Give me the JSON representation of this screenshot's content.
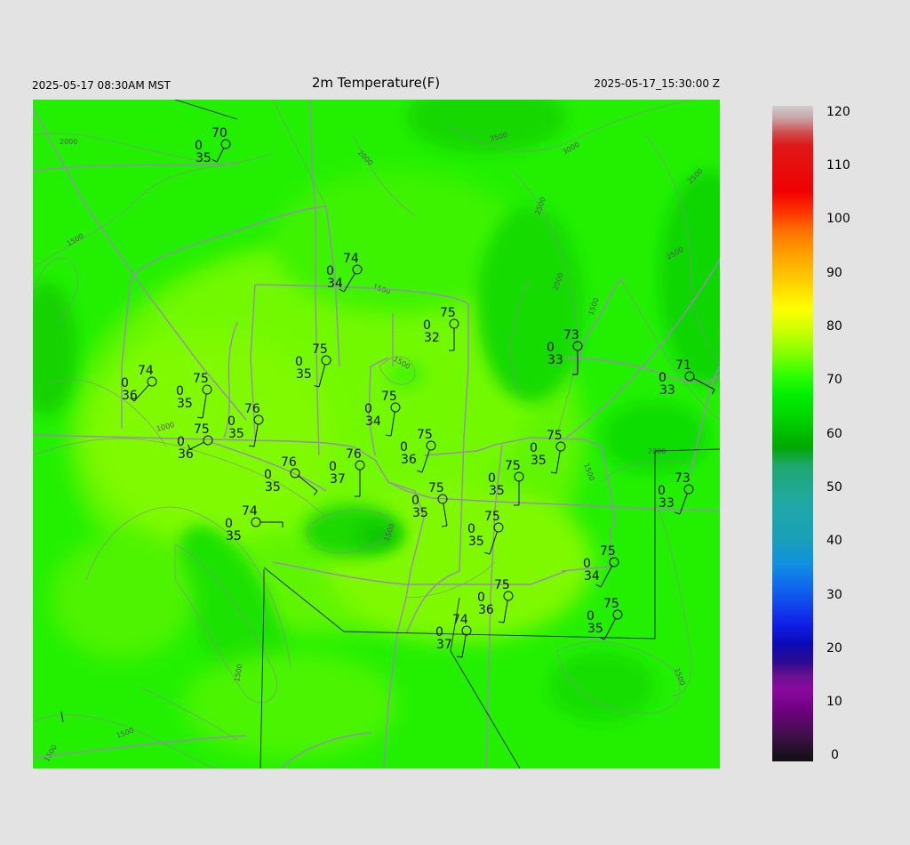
{
  "header": {
    "local_time": "2025-05-17 08:30AM MST",
    "title": "2m Temperature(F)",
    "utc_time": "2025-05-17_15:30:00 Z"
  },
  "map": {
    "base_color": "#22f000",
    "contour_labels": [
      "2000",
      "2000",
      "3500",
      "3000",
      "2500",
      "2500",
      "2500",
      "2000",
      "1500",
      "1500",
      "1500",
      "1500",
      "1000",
      "1500",
      "2000",
      "1500",
      "1500",
      "1500",
      "1500",
      "1500"
    ]
  },
  "stations": [
    {
      "temp": "70",
      "calm": "0",
      "dew": "35"
    },
    {
      "temp": "74",
      "calm": "0",
      "dew": "34"
    },
    {
      "temp": "75",
      "calm": "0",
      "dew": "32"
    },
    {
      "temp": "73",
      "calm": "0",
      "dew": "33"
    },
    {
      "temp": "71",
      "calm": "0",
      "dew": "33"
    },
    {
      "temp": "75",
      "calm": "0",
      "dew": "35"
    },
    {
      "temp": "74",
      "calm": "0",
      "dew": "36"
    },
    {
      "temp": "75",
      "calm": "0",
      "dew": "35"
    },
    {
      "temp": "76",
      "calm": "0",
      "dew": "35"
    },
    {
      "temp": "75",
      "calm": "0",
      "dew": "36"
    },
    {
      "temp": "75",
      "calm": "0",
      "dew": "34"
    },
    {
      "temp": "75",
      "calm": "0",
      "dew": "36"
    },
    {
      "temp": "76",
      "calm": "0",
      "dew": "37"
    },
    {
      "temp": "76",
      "calm": "0",
      "dew": "35"
    },
    {
      "temp": "75",
      "calm": "0",
      "dew": "35"
    },
    {
      "temp": "75",
      "calm": "0",
      "dew": "35"
    },
    {
      "temp": "75",
      "calm": "0",
      "dew": "35"
    },
    {
      "temp": "73",
      "calm": "0",
      "dew": "33"
    },
    {
      "temp": "74",
      "calm": "0",
      "dew": "35"
    },
    {
      "temp": "75",
      "calm": "0",
      "dew": "35"
    },
    {
      "temp": "75",
      "calm": "0",
      "dew": "34"
    },
    {
      "temp": "75",
      "calm": "0",
      "dew": "36"
    },
    {
      "temp": "75",
      "calm": "0",
      "dew": "35"
    },
    {
      "temp": "74",
      "calm": "0",
      "dew": "37"
    }
  ],
  "colorbar": {
    "labels": [
      "120",
      "110",
      "100",
      "90",
      "80",
      "70",
      "60",
      "50",
      "40",
      "30",
      "20",
      "10",
      "0"
    ]
  }
}
